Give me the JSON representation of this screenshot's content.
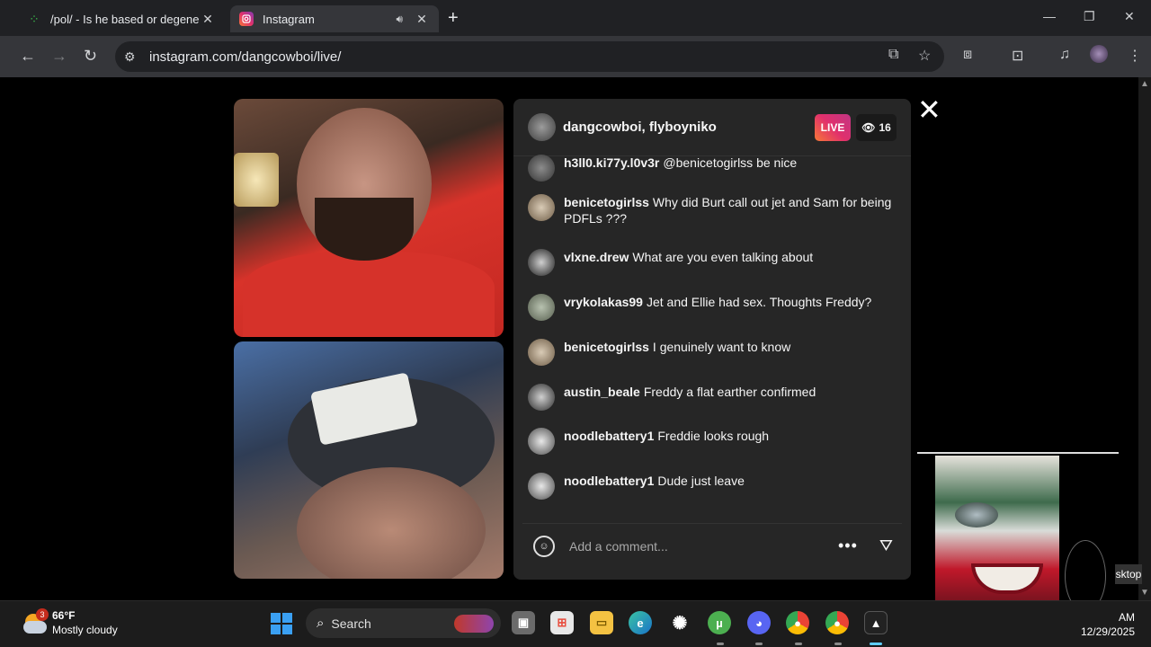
{
  "browser": {
    "tabs": [
      {
        "title": "/pol/ - Is he based or degenera",
        "close": "✕"
      },
      {
        "title": "Instagram",
        "close": "✕"
      }
    ],
    "new_tab": "+",
    "address": "instagram.com/dangcowboi/live/",
    "window_controls": {
      "minimize": "—",
      "restore": "❐",
      "close": "✕"
    }
  },
  "live": {
    "broadcasters": "dangcowboi, flyboyniko",
    "badge": "LIVE",
    "viewer_count": "16",
    "comments": [
      {
        "user": "h3ll0.ki77y.l0v3r",
        "text": "@benicetogirlss be nice"
      },
      {
        "user": "benicetogirlss",
        "text": "Why did Burt call out jet and Sam for being PDFLs ???"
      },
      {
        "user": "vlxne.drew",
        "text": "What are you even talking about"
      },
      {
        "user": "vrykolakas99",
        "text": "Jet and Ellie had sex. Thoughts Freddy?"
      },
      {
        "user": "benicetogirlss",
        "text": "I genuinely want to know"
      },
      {
        "user": "austin_beale",
        "text": "Freddy a flat earther confirmed"
      },
      {
        "user": "noodlebattery1",
        "text": "Freddie looks rough"
      },
      {
        "user": "noodlebattery1",
        "text": "Dude just leave"
      }
    ],
    "comment_placeholder": "Add a comment..."
  },
  "overlay_label": "sktop",
  "taskbar": {
    "weather_temp": "66°F",
    "weather_desc": "Mostly cloudy",
    "weather_badge": "3",
    "search_label": "Search",
    "clock_time": "AM",
    "clock_date": "12/29/2025"
  },
  "colors": {
    "chrome_bg": "#202124",
    "toolbar_bg": "#35363a",
    "panel_bg": "#262626",
    "live_gradient": "#e1306c"
  }
}
